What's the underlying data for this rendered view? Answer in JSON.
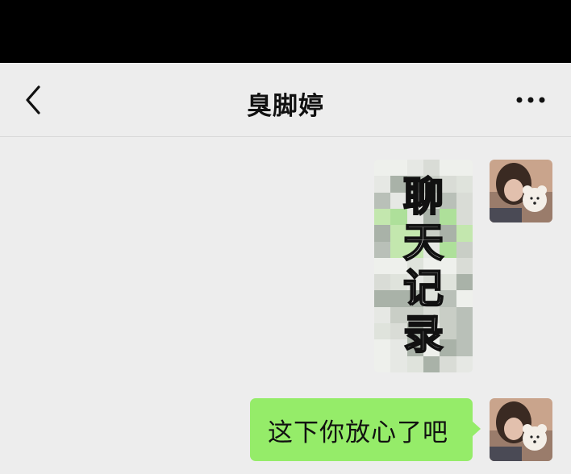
{
  "header": {
    "title": "臭脚婷",
    "back_icon": "chevron-left-icon",
    "more_icon": "more-dots-icon"
  },
  "messages": [
    {
      "type": "image",
      "sender": "self",
      "image_text": [
        "聊",
        "天",
        "记",
        "录"
      ]
    },
    {
      "type": "text",
      "sender": "self",
      "text": "这下你放心了吧"
    }
  ],
  "colors": {
    "status_bar": "#000000",
    "background": "#ededed",
    "bubble_self": "#95ec69"
  }
}
